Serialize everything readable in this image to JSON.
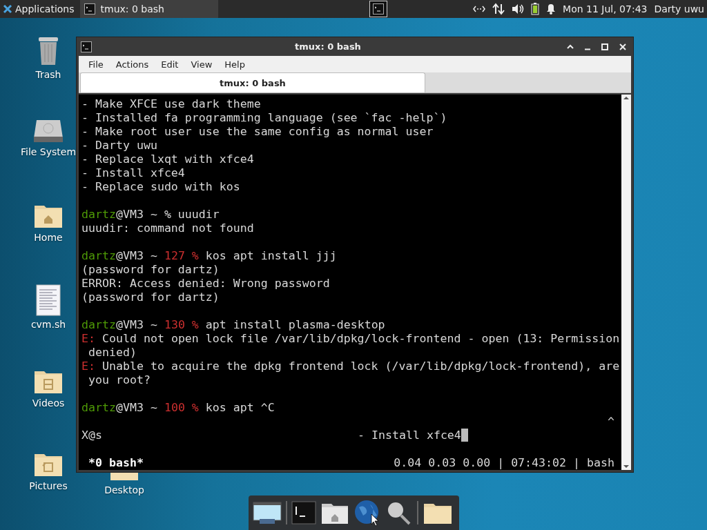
{
  "panel": {
    "apps_label": "Applications",
    "tasks": [
      {
        "label": "tmux: 0 bash",
        "selected": true
      }
    ],
    "clock": "Mon 11 Jul, 07:43",
    "user": "Darty uwu"
  },
  "desktop_icons": [
    {
      "label": "Trash",
      "kind": "trash"
    },
    {
      "label": "File System",
      "kind": "drive"
    },
    {
      "label": "Home",
      "kind": "home"
    },
    {
      "label": "cvm.sh",
      "kind": "document"
    },
    {
      "label": "Videos",
      "kind": "videos"
    },
    {
      "label": "Pictures",
      "kind": "pictures"
    },
    {
      "label": "Desktop",
      "kind": "folder"
    }
  ],
  "window": {
    "title": "tmux: 0 bash",
    "menu": [
      "File",
      "Actions",
      "Edit",
      "View",
      "Help"
    ],
    "tabs": [
      {
        "label": "tmux: 0 bash",
        "selected": true
      }
    ]
  },
  "terminal": {
    "lines": [
      {
        "segments": [
          {
            "text": "- Make XFCE use dark theme",
            "kind": "plain"
          }
        ]
      },
      {
        "segments": [
          {
            "text": "- Installed fa programming language (see `fac -help`)",
            "kind": "plain"
          }
        ]
      },
      {
        "segments": [
          {
            "text": "- Make root user use the same config as normal user",
            "kind": "plain"
          }
        ]
      },
      {
        "segments": [
          {
            "text": "- Darty uwu",
            "kind": "plain"
          }
        ]
      },
      {
        "segments": [
          {
            "text": "- Replace lxqt with xfce4",
            "kind": "plain"
          }
        ]
      },
      {
        "segments": [
          {
            "text": "- Install xfce4",
            "kind": "plain"
          }
        ]
      },
      {
        "segments": [
          {
            "text": "- Replace sudo with kos",
            "kind": "plain"
          }
        ]
      },
      {
        "kind": "blank"
      },
      {
        "segments": [
          {
            "text": "dartz",
            "kind": "user"
          },
          {
            "text": "@VM3 ~ % uuudir",
            "kind": "plain"
          }
        ]
      },
      {
        "segments": [
          {
            "text": "uuudir: command not found",
            "kind": "plain"
          }
        ]
      },
      {
        "kind": "blank"
      },
      {
        "segments": [
          {
            "text": "dartz",
            "kind": "user"
          },
          {
            "text": "@VM3 ~",
            "kind": "plain"
          },
          {
            "text": "127 %",
            "kind": "code"
          },
          {
            "text": "kos apt install jjj",
            "kind": "plain"
          }
        ]
      },
      {
        "segments": [
          {
            "text": "(password for dartz)",
            "kind": "plain"
          }
        ]
      },
      {
        "segments": [
          {
            "text": "ERROR: Access denied: Wrong password",
            "kind": "plain"
          }
        ]
      },
      {
        "segments": [
          {
            "text": "(password for dartz)",
            "kind": "plain"
          }
        ]
      },
      {
        "kind": "blank"
      },
      {
        "segments": [
          {
            "text": "dartz",
            "kind": "user"
          },
          {
            "text": "@VM3 ~",
            "kind": "plain"
          },
          {
            "text": "130 %",
            "kind": "code"
          },
          {
            "text": "apt install plasma-desktop",
            "kind": "plain"
          }
        ]
      },
      {
        "segments": [
          {
            "text": "E:",
            "kind": "code"
          },
          {
            "text": "Could not open lock file /var/lib/dpkg/lock-frontend - open (13: Permission",
            "kind": "plain"
          }
        ]
      },
      {
        "segments": [
          {
            "text": " denied)",
            "kind": "plain"
          }
        ]
      },
      {
        "segments": [
          {
            "text": "E:",
            "kind": "code"
          },
          {
            "text": "Unable to acquire the dpkg frontend lock (/var/lib/dpkg/lock-frontend), are",
            "kind": "plain"
          }
        ]
      },
      {
        "segments": [
          {
            "text": " you root?",
            "kind": "plain"
          }
        ]
      },
      {
        "kind": "blank"
      },
      {
        "segments": [
          {
            "text": "dartz",
            "kind": "user"
          },
          {
            "text": "@VM3 ~",
            "kind": "plain"
          },
          {
            "text": "100 %",
            "kind": "code"
          },
          {
            "text": "kos apt ^C",
            "kind": "plain"
          }
        ]
      },
      {
        "kind": "right",
        "text": "^"
      },
      {
        "kind": "echo",
        "left": "X@s",
        "right": "- Install xfce4",
        "cursor": true
      },
      {
        "kind": "blank"
      }
    ],
    "status": {
      "left": "*0 bash*",
      "right": "0.04 0.03 0.00 | 07:43:02 | bash"
    }
  }
}
